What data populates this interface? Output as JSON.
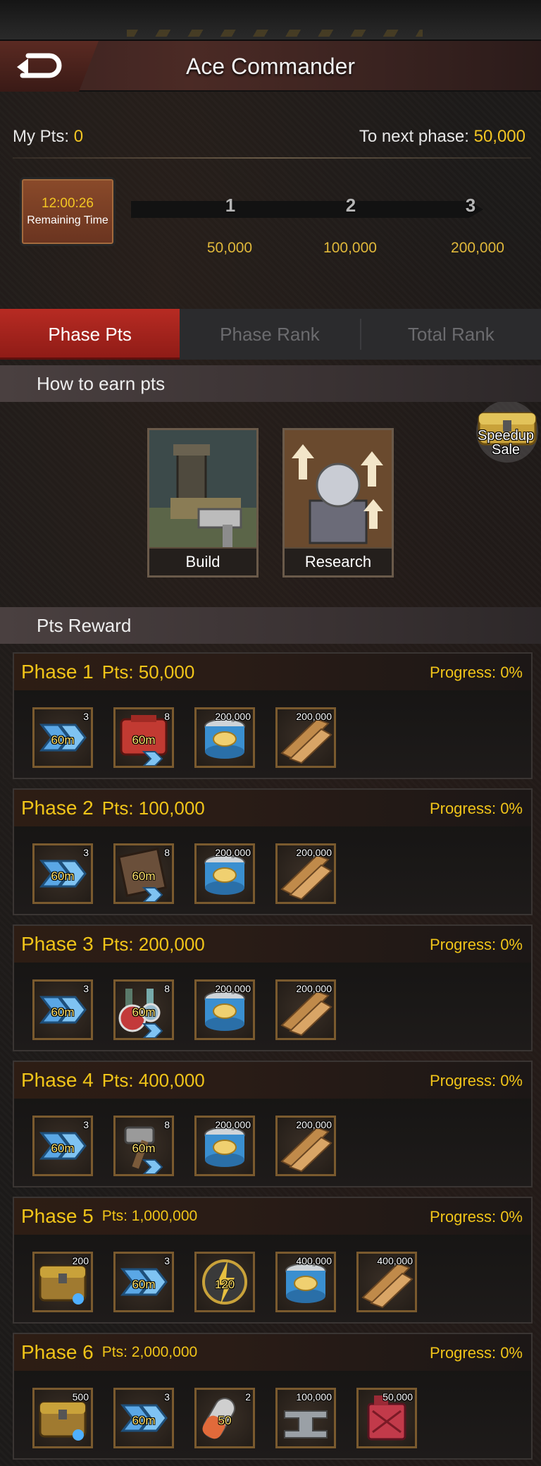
{
  "header": {
    "title": "Ace Commander"
  },
  "points": {
    "my_pts_label": "My Pts:",
    "my_pts_value": "0",
    "next_phase_label": "To next phase:",
    "next_phase_value": "50,000"
  },
  "timer": {
    "time": "12:00:26",
    "label": "Remaining Time"
  },
  "milestones": [
    {
      "num": "1",
      "value": "50,000"
    },
    {
      "num": "2",
      "value": "100,000"
    },
    {
      "num": "3",
      "value": "200,000"
    }
  ],
  "tabs": [
    {
      "label": "Phase Pts",
      "active": true
    },
    {
      "label": "Phase Rank",
      "active": false
    },
    {
      "label": "Total Rank",
      "active": false
    }
  ],
  "earn": {
    "title": "How to earn pts",
    "cards": [
      {
        "label": "Build"
      },
      {
        "label": "Research"
      }
    ],
    "promo": {
      "line1": "Speedup",
      "line2": "Sale"
    }
  },
  "rewards_title": "Pts Reward",
  "phases": [
    {
      "name": "Phase 1",
      "pts": "Pts: 50,000",
      "progress": "Progress: 0%",
      "items": [
        {
          "icon": "speedup-icon",
          "count": "3",
          "label": "60m"
        },
        {
          "icon": "build-speedup-icon",
          "count": "8",
          "label": "60m"
        },
        {
          "icon": "food-can-icon",
          "count": "200,000",
          "label": ""
        },
        {
          "icon": "wood-icon",
          "count": "200,000",
          "label": ""
        }
      ]
    },
    {
      "name": "Phase 2",
      "pts": "Pts: 100,000",
      "progress": "Progress: 0%",
      "items": [
        {
          "icon": "speedup-icon",
          "count": "3",
          "label": "60m"
        },
        {
          "icon": "training-speedup-icon",
          "count": "8",
          "label": "60m"
        },
        {
          "icon": "food-can-icon",
          "count": "200,000",
          "label": ""
        },
        {
          "icon": "wood-icon",
          "count": "200,000",
          "label": ""
        }
      ]
    },
    {
      "name": "Phase 3",
      "pts": "Pts: 200,000",
      "progress": "Progress: 0%",
      "items": [
        {
          "icon": "speedup-icon",
          "count": "3",
          "label": "60m"
        },
        {
          "icon": "research-speedup-icon",
          "count": "8",
          "label": "60m"
        },
        {
          "icon": "food-can-icon",
          "count": "200,000",
          "label": ""
        },
        {
          "icon": "wood-icon",
          "count": "200,000",
          "label": ""
        }
      ]
    },
    {
      "name": "Phase 4",
      "pts": "Pts: 400,000",
      "progress": "Progress: 0%",
      "items": [
        {
          "icon": "speedup-icon",
          "count": "3",
          "label": "60m"
        },
        {
          "icon": "hammer-speedup-icon",
          "count": "8",
          "label": "60m"
        },
        {
          "icon": "food-can-icon",
          "count": "200,000",
          "label": ""
        },
        {
          "icon": "wood-icon",
          "count": "200,000",
          "label": ""
        }
      ]
    },
    {
      "name": "Phase 5",
      "pts": "Pts: 1,000,000",
      "progress": "Progress: 0%",
      "items": [
        {
          "icon": "treasure-chest-icon",
          "count": "200",
          "label": ""
        },
        {
          "icon": "speedup-icon",
          "count": "3",
          "label": "60m"
        },
        {
          "icon": "stamina-icon",
          "count": "",
          "label": "120"
        },
        {
          "icon": "food-can-icon",
          "count": "400,000",
          "label": ""
        },
        {
          "icon": "wood-icon",
          "count": "400,000",
          "label": ""
        }
      ]
    },
    {
      "name": "Phase 6",
      "pts": "Pts: 2,000,000",
      "progress": "Progress: 0%",
      "items": [
        {
          "icon": "treasure-chest-icon",
          "count": "500",
          "label": ""
        },
        {
          "icon": "speedup-icon",
          "count": "3",
          "label": "60m"
        },
        {
          "icon": "capsule-icon",
          "count": "2",
          "label": "50"
        },
        {
          "icon": "steel-icon",
          "count": "100,000",
          "label": ""
        },
        {
          "icon": "oil-can-icon",
          "count": "50,000",
          "label": ""
        }
      ]
    }
  ]
}
